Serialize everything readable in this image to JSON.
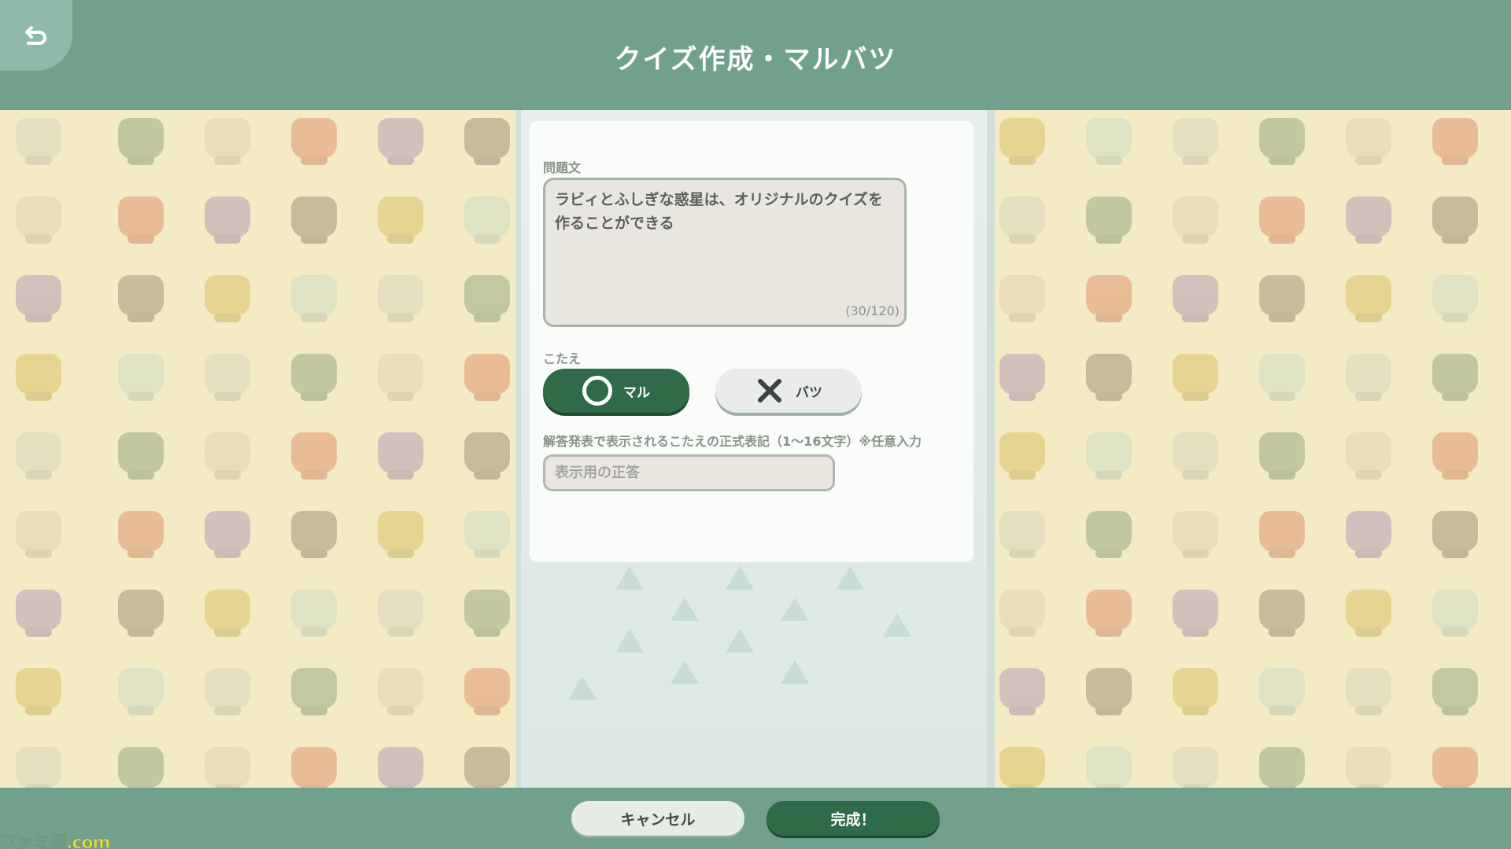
{
  "header": {
    "title": "クイズ作成・マルバツ",
    "back_icon": "back-arrow-icon"
  },
  "form": {
    "question_label": "問題文",
    "question_text_line1": "ラビィとふしぎな惑星は、オリジナルのクイズを",
    "question_text_line2": "作ることができる",
    "question_counter": "(30/120)",
    "answer_label": "こたえ",
    "answer_options": [
      {
        "label": "マル",
        "icon": "circle-icon",
        "selected": true
      },
      {
        "label": "バツ",
        "icon": "cross-icon",
        "selected": false
      }
    ],
    "display_answer_label": "解答発表で表示されるこたえの正式表記（1〜16文字）※任意入力",
    "display_answer_placeholder": "表示用の正答",
    "display_answer_value": ""
  },
  "footer": {
    "cancel_label": "キャンセル",
    "done_label": "完成！"
  },
  "watermark": "ファミ通.com",
  "colors": {
    "header_bg": "#71a18c",
    "accent_dark_green": "#2f6b48",
    "pattern_bg": "#f3ebc3",
    "card_bg": "#fafcf9"
  }
}
